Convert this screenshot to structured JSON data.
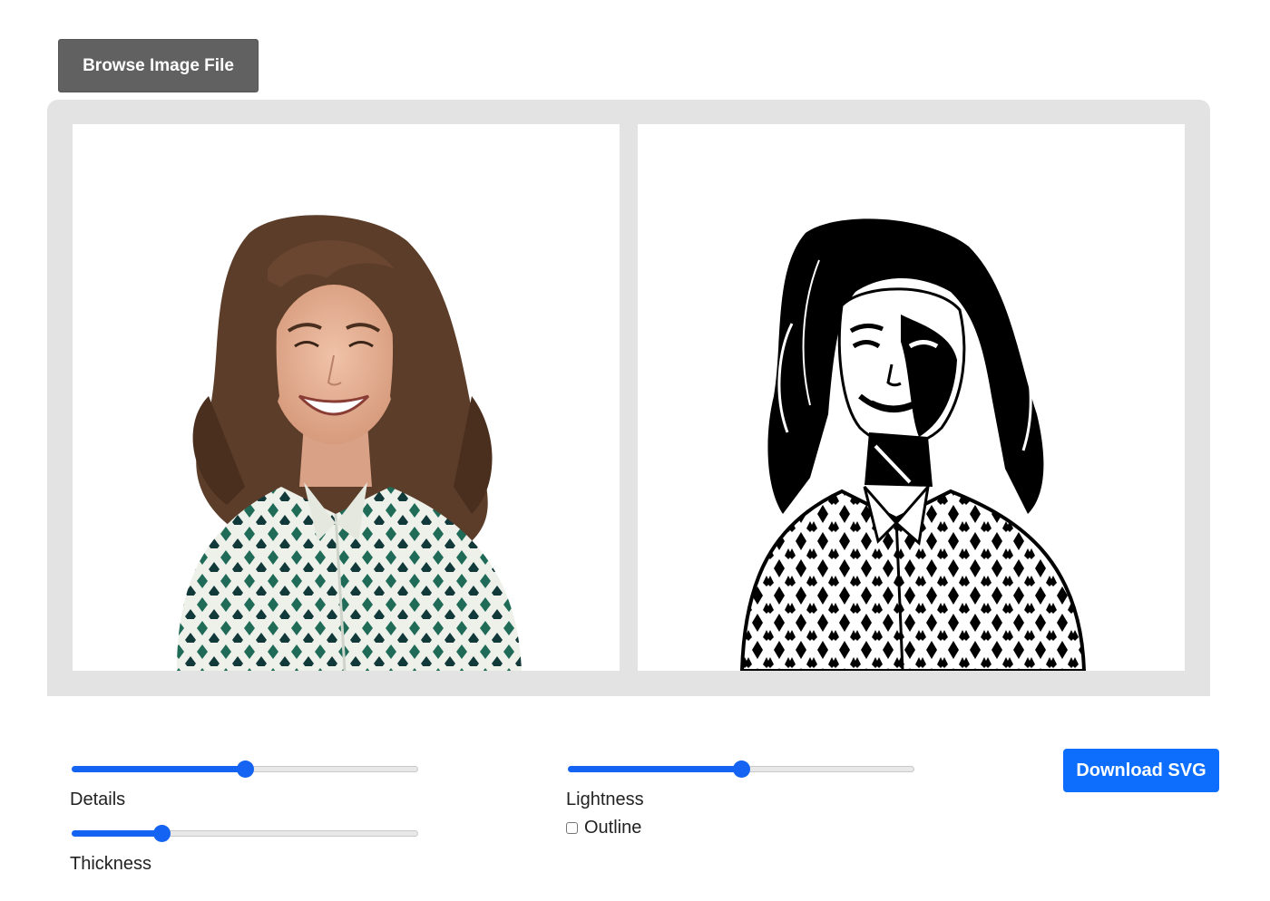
{
  "toolbar": {
    "browse_label": "Browse Image File"
  },
  "images": {
    "original_alt": "Original photo",
    "vectorized_alt": "Vectorized output"
  },
  "controls": {
    "details": {
      "label": "Details",
      "value": 0.5
    },
    "thickness": {
      "label": "Thickness",
      "value": 0.26
    },
    "lightness": {
      "label": "Lightness",
      "value": 0.5
    },
    "outline": {
      "label": "Outline",
      "checked": false
    },
    "download_label": "Download SVG"
  },
  "colors": {
    "accent": "#0d6efd",
    "slider_fill": "#1463f3",
    "browse_bg": "#616161",
    "stage_bg": "#e3e3e3",
    "shirt_green": "#1f6b58",
    "shirt_dark": "#12393a",
    "shirt_light": "#eef1ea",
    "hair": "#5b3d29",
    "skin": "#e7b49a"
  }
}
